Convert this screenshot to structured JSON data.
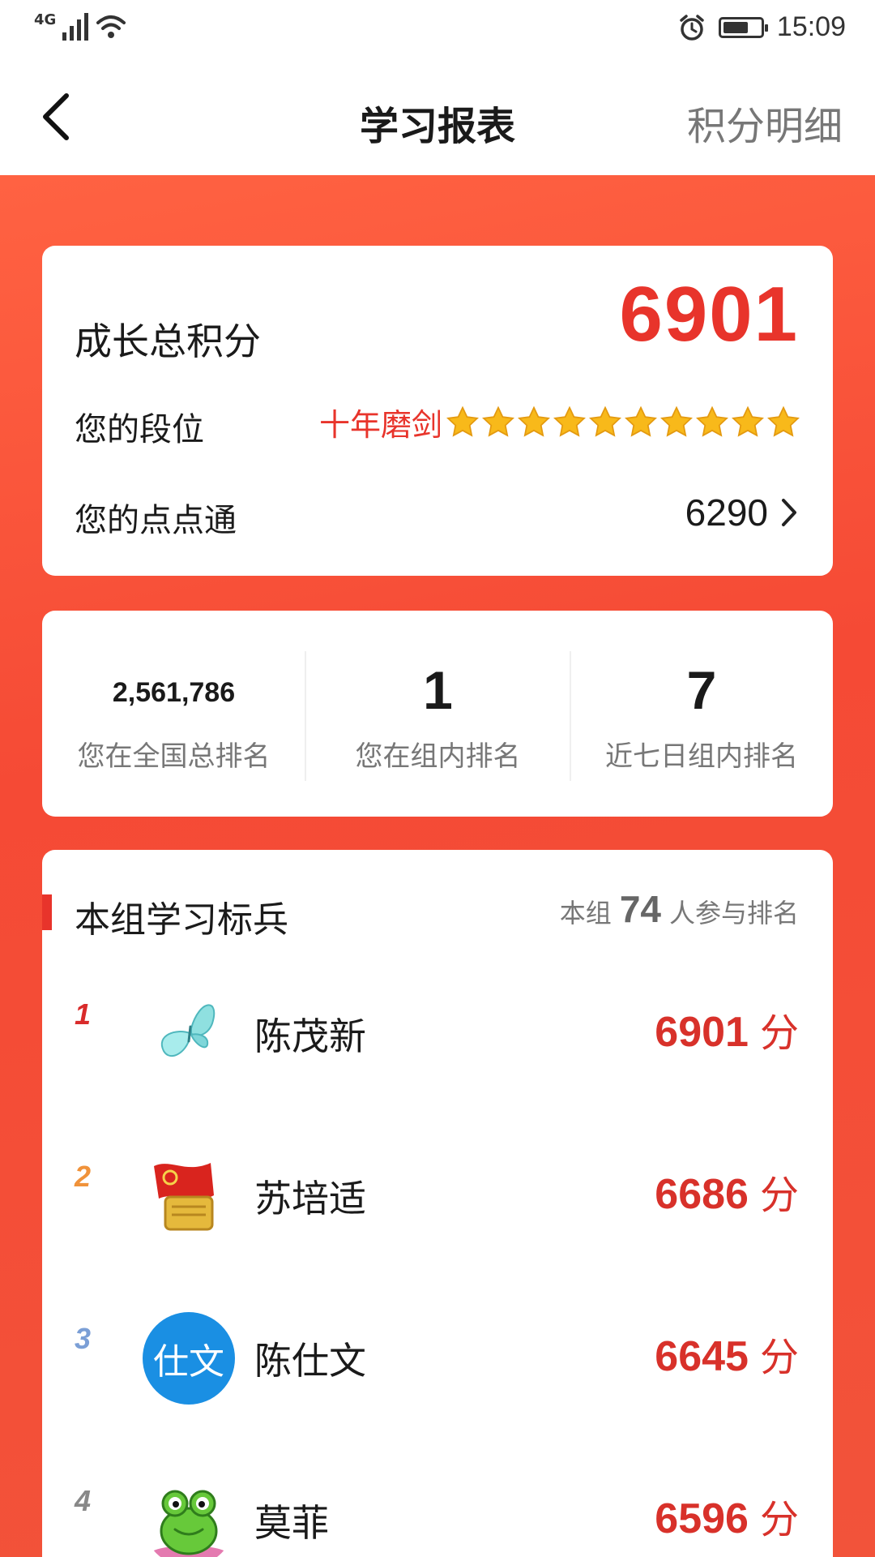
{
  "status_bar": {
    "network": "4G",
    "time": "15:09"
  },
  "header": {
    "title": "学习报表",
    "detail_link": "积分明细"
  },
  "summary": {
    "total_label": "成长总积分",
    "total_value": "6901",
    "rank_label": "您的段位",
    "rank_title": "十年磨剑",
    "rank_stars": 10,
    "coin_label": "您的点点通",
    "coin_value": "6290"
  },
  "stats": [
    {
      "value": "2,561,786",
      "label": "您在全国总排名"
    },
    {
      "value": "1",
      "label": "您在组内排名"
    },
    {
      "value": "7",
      "label": "近七日组内排名"
    }
  ],
  "group": {
    "title": "本组学习标兵",
    "count_prefix": "本组",
    "count": "74",
    "count_suffix": "人参与排名",
    "score_unit": "分",
    "rank_colors": [
      "#d92b2b",
      "#f0923a",
      "#7b9fd6",
      "#888888"
    ],
    "members": [
      {
        "rank": "1",
        "name": "陈茂新",
        "score": "6901",
        "avatar": "butterfly-avatar"
      },
      {
        "rank": "2",
        "name": "苏培适",
        "score": "6686",
        "avatar": "flag-badge-avatar"
      },
      {
        "rank": "3",
        "name": "陈仕文",
        "score": "6645",
        "avatar": "text-avatar",
        "avatar_text": "仕文"
      },
      {
        "rank": "4",
        "name": "莫菲",
        "score": "6596",
        "avatar": "frog-avatar"
      }
    ]
  },
  "colors": {
    "accent": "#e8342b",
    "background_red": "#f54a35"
  }
}
